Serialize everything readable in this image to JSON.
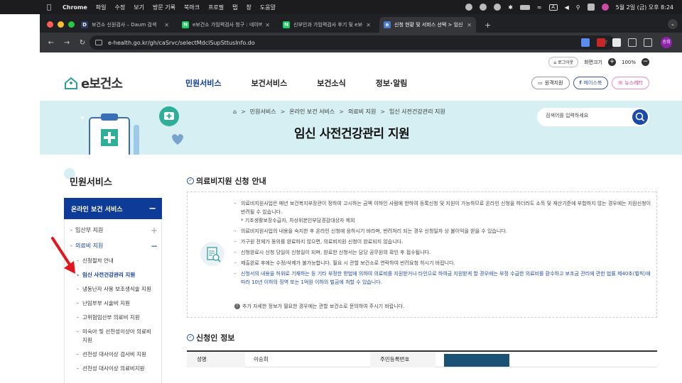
{
  "menubar": {
    "app": "Chrome",
    "items": [
      "파일",
      "수정",
      "보기",
      "방문 기록",
      "북마크",
      "프로필",
      "탭",
      "창",
      "도움말"
    ],
    "datetime": "5월 2일 (금) 오후 8:24",
    "input_indicator": "A"
  },
  "tabs": [
    {
      "title": "보건소 신원검사 – Daum 검색",
      "favicon": "D",
      "color": "#2b3a67"
    },
    {
      "title": "e보건소 가임력검사 청구 : 네이버 블로그",
      "favicon": "N",
      "color": "#19ce60"
    },
    {
      "title": "신부인과 가임력검사 후기 및 e보건소",
      "favicon": "N",
      "color": "#19ce60"
    },
    {
      "title": "신청 현황 및 서비스 선택 > 임신 사전",
      "favicon": "e",
      "color": "#4a7bd0"
    }
  ],
  "browser": {
    "url": "e-health.go.kr/gh/caSrvc/selectMdclSupSttusInfo.do",
    "profile_label": "승희"
  },
  "util": {
    "login": "로그아웃",
    "zoom_label": "화면크기",
    "zoom_value": "100%"
  },
  "site": {
    "logo_text": "e보건소",
    "gnb": [
      "민원서비스",
      "보건서비스",
      "보건소식",
      "정보·알림"
    ],
    "sns": [
      "원격지원",
      "페이스북",
      "뉴스레터"
    ]
  },
  "banner": {
    "breadcrumb": [
      "민원서비스",
      "온라인 보건 서비스",
      "의료비 지원",
      "임신 사전건강관리 지원"
    ],
    "title": "임신 사전건강관리 지원",
    "search_placeholder": "검색어를 입력하세요"
  },
  "sidebar": {
    "title": "민원서비스",
    "header": "온라인 보건 서비스",
    "items": [
      {
        "label": "임산부 지원",
        "sign": "+"
      },
      {
        "label": "의료비 지원",
        "sign": "−"
      }
    ],
    "subitems": [
      "신청절차 안내",
      "임신 사전건강관리 지원",
      "냉동난자 사용 보조생식술 지원",
      "난임부부 시술비 지원",
      "고위험임산부 의료비 지원",
      "미숙아 및 선천성이상아 의료비 지원",
      "선천성 대사이상 검사비 지원",
      "선천성 대사이상 의료비지원"
    ]
  },
  "content": {
    "section1_title": "의료비지원 신청 안내",
    "guide": [
      "의료비지원사업은 매년 보건복지부장관이 정하여 고시하는 금액 이하인 사람에 한하여 등록신청 및 지원이 가능하므로 온라인 신청을 하더라도 소득 및 재산기준에 부합하지 않는 경우에는 지원신청이 반려될 수 있습니다.",
      "* 기초생활보장수급자, 차상위본인부담경감대상자 제외",
      "의료비지원사업의 내용을 숙지한 후 온라인 신청에 응하시기 바라며, 반려처리 되는 경우 신청일자 상 불이익을 받을 수 있습니다.",
      "가구원 전체가 동의를 완료하지 않으면, 의료비지원 신청이 완료되지 않습니다.",
      "신청완료시 신청 당일이 신청일이 되며, 완료한 신청서는 담당 공무원의 확인 후 접수됩니다.",
      "제출완료 후에는 수정/삭제가 불가능합니다. 필요 시 관할 보건소로 연락하여 반려요청 하시기 바랍니다.",
      "신청서의 내용을 허위로 기재하는 등 기타 부정한 방법에 의하여 의료비를 지원받거나 타인으로 하여금 지원받게 할 경우에는 부정 수급한 의료비를 환수하고 보조금 관리에 관한 법률 제40조(벌칙)에 따라 10년 이하의 징역 또는 1억원 이하의 벌금에 처할 수 있습니다."
    ],
    "note": "추가 자세한 정보가 필요한 경우에는 관할 보건소로 문의하여 주시기 바랍니다.",
    "section2_title": "신청인 정보",
    "table": {
      "name_label": "성명",
      "name_value": "이승희",
      "rrn_label": "주민등록번호"
    }
  },
  "colors": {
    "primary": "#0d3b97",
    "banner_bg": "#d5eff2",
    "arrow": "#e3161d"
  }
}
